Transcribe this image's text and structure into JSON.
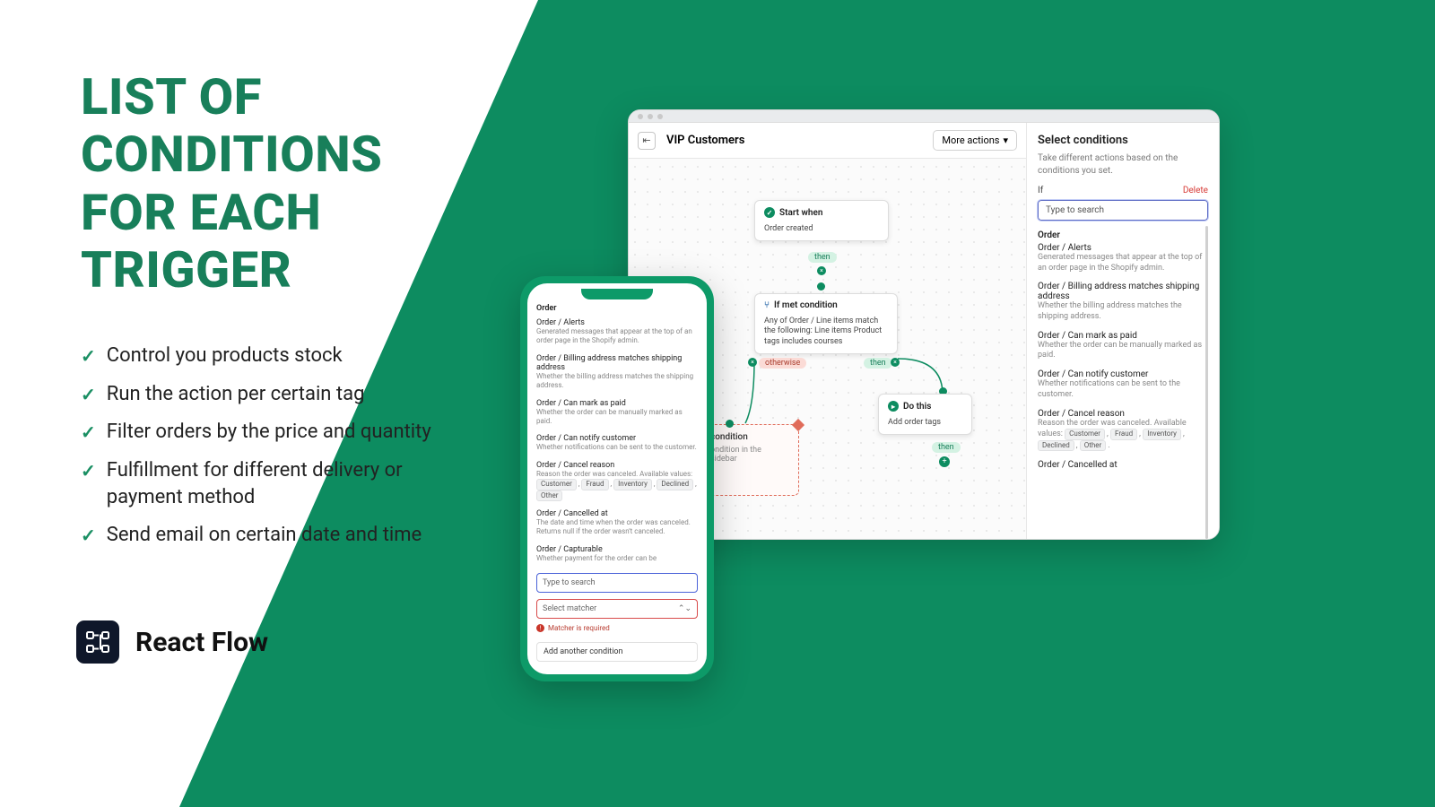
{
  "headline": "LIST OF\nCONDITIONS\nFOR EACH\nTRIGGER",
  "bullets": [
    "Control you products stock",
    "Run the action per certain tag",
    "Filter orders by the price and quantity",
    "Fulfillment for different delivery or payment method",
    "Send email on certain date and time"
  ],
  "brand": {
    "name": "React Flow"
  },
  "window": {
    "title": "VIP Customers",
    "more_actions": "More actions",
    "nodes": {
      "start": {
        "title": "Start when",
        "sub": "Order created"
      },
      "if": {
        "title": "If met condition",
        "sub": "Any of Order / Line items match the following: Line items Product tags includes courses"
      },
      "do": {
        "title": "Do this",
        "sub": "Add order tags"
      },
      "dashed": {
        "title": "condition",
        "sub": "ondition in the sidebar"
      }
    },
    "chips": {
      "then": "then",
      "otherwise": "otherwise"
    },
    "sidebar": {
      "title": "Select conditions",
      "sub": "Take different actions based on the conditions you set.",
      "if_label": "If",
      "delete": "Delete",
      "placeholder": "Type to search",
      "group": "Order",
      "items": [
        {
          "t": "Order / Alerts",
          "d": "Generated messages that appear at the top of an order page in the Shopify admin."
        },
        {
          "t": "Order / Billing address matches shipping address",
          "d": "Whether the billing address matches the shipping address."
        },
        {
          "t": "Order / Can mark as paid",
          "d": "Whether the order can be manually marked as paid."
        },
        {
          "t": "Order / Can notify customer",
          "d": "Whether notifications can be sent to the customer."
        },
        {
          "t": "Order / Cancel reason",
          "d": "Reason the order was canceled. Available values:",
          "pills": [
            "Customer",
            "Fraud",
            "Inventory",
            "Declined",
            "Other"
          ]
        },
        {
          "t": "Order / Cancelled at",
          "d": ""
        }
      ]
    }
  },
  "phone": {
    "group": "Order",
    "items": [
      {
        "t": "Order / Alerts",
        "d": "Generated messages that appear at the top of an order page in the Shopify admin."
      },
      {
        "t": "Order / Billing address matches shipping address",
        "d": "Whether the billing address matches the shipping address."
      },
      {
        "t": "Order / Can mark as paid",
        "d": "Whether the order can be manually marked as paid."
      },
      {
        "t": "Order / Can notify customer",
        "d": "Whether notifications can be sent to the customer."
      },
      {
        "t": "Order / Cancel reason",
        "d": "Reason the order was canceled. Available values:",
        "pills": [
          "Customer",
          "Fraud",
          "Inventory",
          "Declined",
          "Other"
        ]
      },
      {
        "t": "Order / Cancelled at",
        "d": "The date and time when the order was canceled. Returns null if the order wasn't canceled."
      },
      {
        "t": "Order / Capturable",
        "d": "Whether payment for the order can be"
      }
    ],
    "search_placeholder": "Type to search",
    "select_placeholder": "Select matcher",
    "error": "Matcher is required",
    "add": "Add another condition"
  }
}
